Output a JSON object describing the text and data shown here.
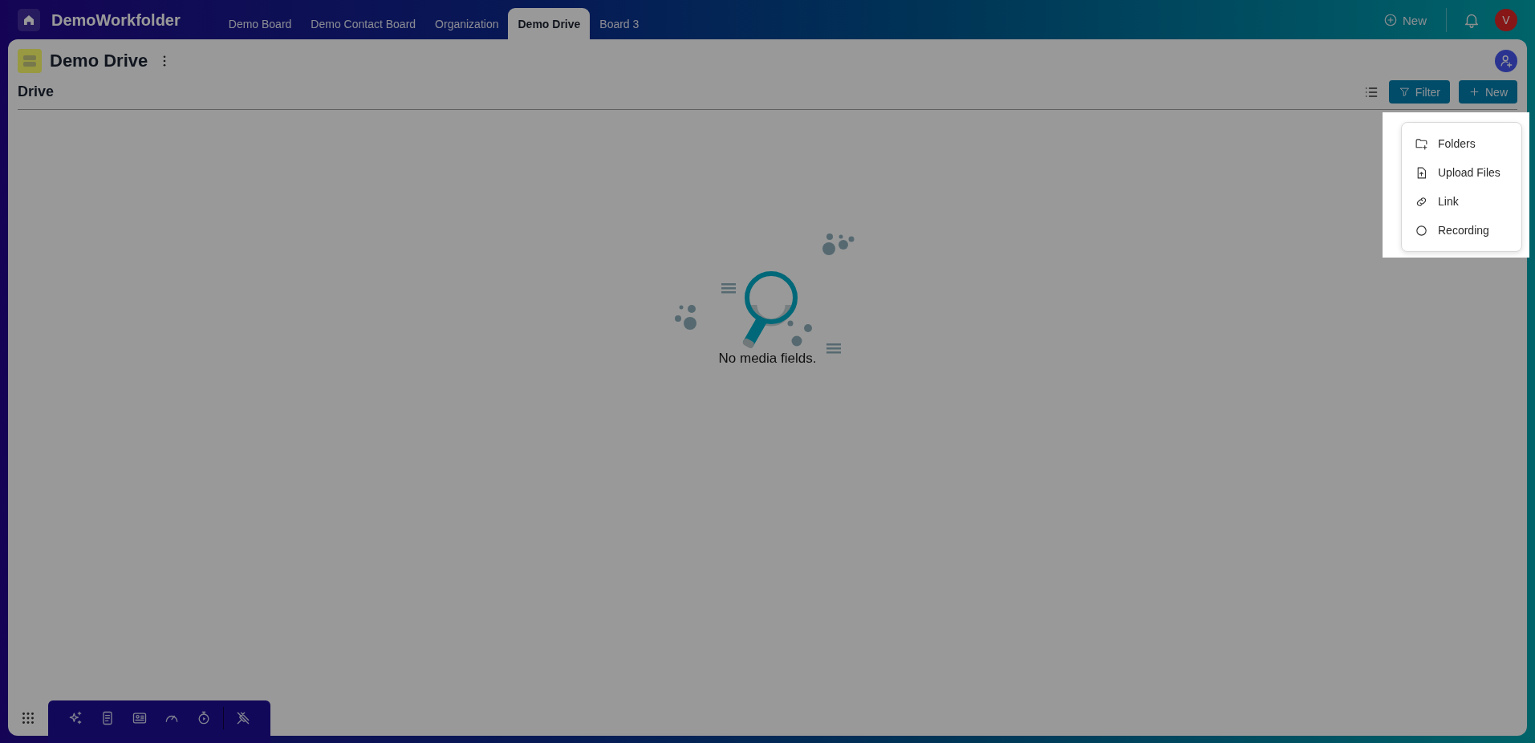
{
  "app": {
    "title": "DemoWorkfolder"
  },
  "tabs": [
    {
      "label": "Demo Board",
      "selected": false
    },
    {
      "label": "Demo Contact Board",
      "selected": false
    },
    {
      "label": "Organization",
      "selected": false
    },
    {
      "label": "Demo Drive",
      "selected": true
    },
    {
      "label": "Board 3",
      "selected": false
    }
  ],
  "top_actions": {
    "new_label": "New",
    "avatar_initial": "V"
  },
  "page": {
    "title": "Demo Drive",
    "section": "Drive"
  },
  "toolbar": {
    "filter_label": "Filter",
    "new_label": "New"
  },
  "new_menu": {
    "items": [
      {
        "kind": "folder",
        "label": "Folders"
      },
      {
        "kind": "upload",
        "label": "Upload Files"
      },
      {
        "kind": "link",
        "label": "Link"
      },
      {
        "kind": "recording",
        "label": "Recording"
      }
    ]
  },
  "empty_state": {
    "message": "No media fields."
  }
}
